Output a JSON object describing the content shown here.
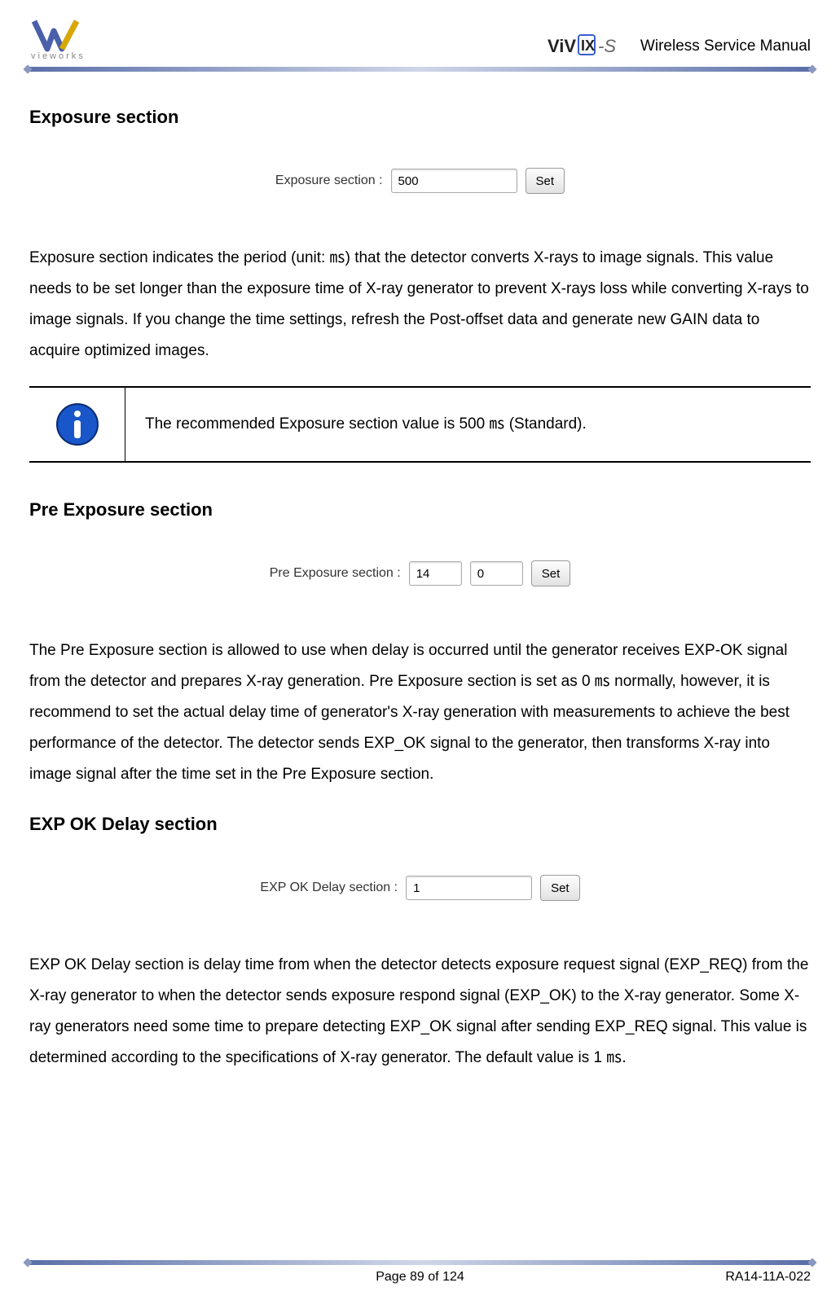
{
  "header": {
    "brand_text": "vieworks",
    "product_logo_text": "ViVIX -S",
    "manual_title": "Wireless Service Manual"
  },
  "sections": {
    "exposure": {
      "heading": "Exposure section",
      "ui": {
        "label": "Exposure section :",
        "value": "500",
        "button": "Set"
      },
      "body": "Exposure section indicates the period (unit: ㎳) that the detector converts X-rays to image signals. This value needs to be set longer than the exposure time of X-ray generator to prevent X-rays loss while converting X-rays to image signals. If you change the time settings, refresh the Post-offset data and generate new GAIN data to acquire optimized images.",
      "info": "The recommended Exposure section value is 500 ㎳ (Standard)."
    },
    "pre_exposure": {
      "heading": "Pre Exposure section",
      "ui": {
        "label": "Pre Exposure section :",
        "value1": "14",
        "value2": "0",
        "button": "Set"
      },
      "body": "The Pre Exposure section is allowed to use when delay is occurred until the generator receives EXP-OK signal from the detector and prepares X-ray generation. Pre Exposure section is set as 0 ㎳ normally, however, it is recommend to set the actual delay time of generator's X-ray generation with measurements to achieve the best performance of the detector. The detector sends EXP_OK signal to the generator, then transforms X-ray into image signal after the time set in the Pre Exposure section."
    },
    "exp_ok_delay": {
      "heading": "EXP OK Delay section",
      "ui": {
        "label": "EXP OK Delay section :",
        "value": "1",
        "button": "Set"
      },
      "body": "EXP OK Delay section is delay time from when the detector detects exposure request signal (EXP_REQ) from the X-ray generator to when the detector sends exposure respond signal (EXP_OK) to the X-ray generator. Some X-ray generators need some time to prepare detecting EXP_OK signal after sending EXP_REQ signal. This value is determined according to the specifications of X-ray generator. The default value is 1 ㎳."
    }
  },
  "footer": {
    "page": "Page 89 of 124",
    "doc_id": "RA14-11A-022"
  }
}
